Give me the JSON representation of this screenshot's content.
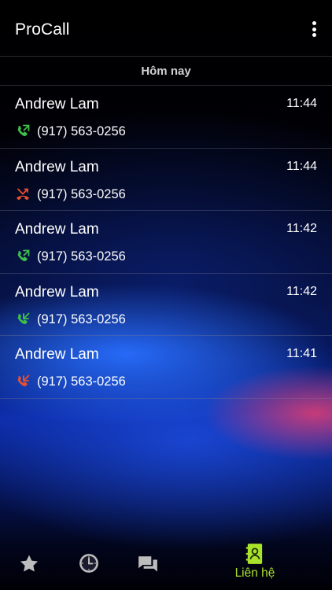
{
  "app": {
    "title": "ProCall"
  },
  "section": {
    "label": "Hôm nay"
  },
  "calls": [
    {
      "name": "Andrew Lam",
      "number": "(917) 563-0256",
      "time": "11:44",
      "type": "outgoing",
      "icon": "outgoing-call-icon",
      "color": "#3fbf4a"
    },
    {
      "name": "Andrew Lam",
      "number": "(917) 563-0256",
      "time": "11:44",
      "type": "missed",
      "icon": "missed-call-icon",
      "color": "#e8502e"
    },
    {
      "name": "Andrew Lam",
      "number": "(917) 563-0256",
      "time": "11:42",
      "type": "outgoing",
      "icon": "outgoing-call-icon",
      "color": "#3fbf4a"
    },
    {
      "name": "Andrew Lam",
      "number": "(917) 563-0256",
      "time": "11:42",
      "type": "incoming",
      "icon": "incoming-call-icon",
      "color": "#3fbf4a"
    },
    {
      "name": "Andrew Lam",
      "number": "(917) 563-0256",
      "time": "11:41",
      "type": "incoming-missed",
      "icon": "incoming-missed-call-icon",
      "color": "#e8502e"
    }
  ],
  "nav": {
    "favorites_icon": "star-icon",
    "recents_icon": "clock-icon",
    "messages_icon": "chat-icon",
    "contacts_icon": "contacts-book-icon",
    "contacts_label": "Liên hệ",
    "active_color": "#a8e22a"
  }
}
